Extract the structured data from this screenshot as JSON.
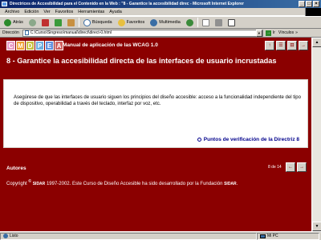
{
  "window": {
    "title": "Directrices de Accesibilidad para el Contenido en la Web : \"8 - Garantice la accesibilidad direc - Microsoft Internet Explorer",
    "minimize": "_",
    "maximize": "□",
    "close": "×"
  },
  "menu": [
    "Archivo",
    "Edición",
    "Ver",
    "Favoritos",
    "Herramientas",
    "Ayuda"
  ],
  "toolbar": {
    "back_label": "Atrás",
    "search_label": "Búsqueda",
    "favorites_label": "Favoritos",
    "multimedia_label": "Multimedia"
  },
  "address": {
    "label": "Dirección",
    "value": "C:\\Curso\\Singreso\\manual\\direct\\direct-0.html",
    "go_label": "Ir",
    "links_label": "Vínculos",
    "links_arrow": "»"
  },
  "page": {
    "letters": [
      {
        "char": "C",
        "color": "#e89bc6"
      },
      {
        "char": "M",
        "color": "#f0a030"
      },
      {
        "char": "D",
        "color": "#c8c040"
      },
      {
        "char": "P",
        "color": "#70b0e0"
      },
      {
        "char": "E",
        "color": "#6090e0"
      },
      {
        "char": "A",
        "color": "#d06060"
      }
    ],
    "manual_title": "Manual de aplicación de las WCAG 1.0",
    "nav_icons": [
      "↑",
      "☰",
      "⊡",
      "→"
    ],
    "heading": "8 - Garantice la accesibilidad directa de las interfaces de usuario incrustadas",
    "body_text": "Asegúrese de que las interfaces de usuario siguen los principios del diseño accesible: acceso a la funcionalidad independiente del tipo de dispositivo, operabilidad a través del teclado, interfaz por voz, etc.",
    "verification_link": "Puntos de verificación de la Directriz 8",
    "authors": "Autores",
    "page_count": "8 de 14",
    "prev": "←",
    "next": "→",
    "copyright_prefix": "Copyright",
    "copyright_brand": "SIDAR",
    "copyright_middle": "1997-2002. Este Curso de Diseño Accesible ha sido desarrollado por la Fundación",
    "copyright_end": "."
  },
  "status": {
    "text": "Listo",
    "zone": "Mi PC"
  },
  "colors": {
    "page_background": "#8b0000",
    "title_bar": "#0a246a",
    "chrome": "#d4d0c8",
    "link": "#00008b"
  }
}
